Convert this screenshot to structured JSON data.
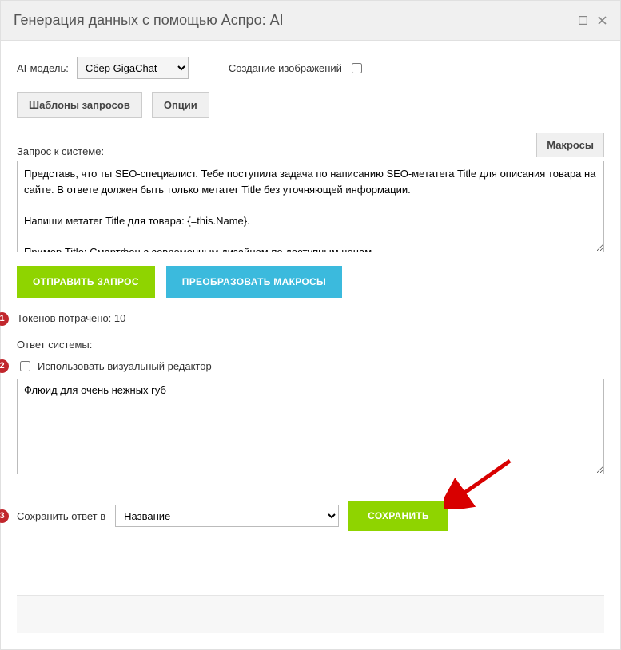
{
  "header": {
    "title": "Генерация данных с помощью Аспро: AI"
  },
  "model": {
    "label": "AI-модель:",
    "selected": "Сбер GigaChat"
  },
  "imageGen": {
    "label": "Создание изображений",
    "checked": false
  },
  "buttons": {
    "templates": "Шаблоны запросов",
    "options": "Опции",
    "macros": "Макросы",
    "send": "ОТПРАВИТЬ ЗАПРОС",
    "transform": "ПРЕОБРАЗОВАТЬ МАКРОСЫ",
    "save": "СОХРАНИТЬ"
  },
  "query": {
    "label": "Запрос к системе:",
    "value": "Представь, что ты SEO-специалист. Тебе поступила задача по написанию SEO-метатега Title для описания товара на сайте. В ответе должен быть только метатег Title без уточняющей информации.\n\nНапиши метатег Title для товара: {=this.Name}.\n\nПример Title: Смартфон с современным дизайном по доступным ценам."
  },
  "tokens": {
    "label": "Токенов потрачено:",
    "value": "10"
  },
  "response": {
    "label": "Ответ системы:",
    "visualEditorLabel": "Использовать визуальный редактор",
    "visualEditorChecked": false,
    "value": "Флюид для очень нежных губ"
  },
  "saveTo": {
    "label": "Сохранить ответ в",
    "selected": "Название"
  },
  "badges": {
    "b1": "1",
    "b2": "2",
    "b3": "3"
  }
}
